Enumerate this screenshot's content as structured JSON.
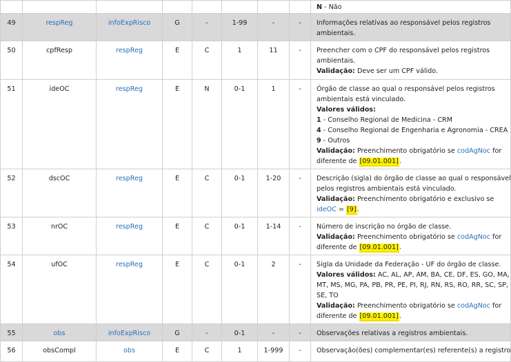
{
  "top_row": {
    "bold": "N",
    "text": " - Não"
  },
  "rows": [
    {
      "num": "49",
      "name": "respReg",
      "parent": "infoExpRisco",
      "type": "G",
      "occ": "-",
      "card": "1-99",
      "size": "-",
      "dec": "-",
      "desc": {
        "l1": "Informações relativas ao responsável pelos registros",
        "l2": "ambientais."
      }
    },
    {
      "num": "50",
      "name": "cpfResp",
      "parent": "respReg",
      "type": "E",
      "occ": "C",
      "card": "1",
      "size": "11",
      "dec": "-",
      "desc": {
        "l1": "Preencher com o CPF do responsável pelos registros",
        "l2": "ambientais.",
        "val_label": "Validação:",
        "val_text": " Deve ser um CPF válido."
      }
    },
    {
      "num": "51",
      "name": "ideOC",
      "parent": "respReg",
      "type": "E",
      "occ": "N",
      "card": "0-1",
      "size": "1",
      "dec": "-",
      "desc": {
        "l1": "Órgão de classe ao qual o responsável pelos registros",
        "l2": "ambientais está vinculado.",
        "valid_label": "Valores válidos:",
        "v1_code": "1",
        "v1_text": " - Conselho Regional de Medicina - CRM",
        "v2_code": "4",
        "v2_text": " - Conselho Regional de Engenharia e Agronomia - CREA",
        "v3_code": "9",
        "v3_text": " - Outros",
        "val_label": "Validação:",
        "val_text": " Preenchimento obrigatório se ",
        "val_link": "codAgNoc",
        "val_text2": " for",
        "val_l2": "diferente de ",
        "val_hl": "[09.01.001]",
        "val_end": "."
      }
    },
    {
      "num": "52",
      "name": "dscOC",
      "parent": "respReg",
      "type": "E",
      "occ": "C",
      "card": "0-1",
      "size": "1-20",
      "dec": "-",
      "desc": {
        "l1": "Descrição (sigla) do órgão de classe ao qual o responsável",
        "l2": "pelos registros ambientais está vinculado.",
        "val_label": "Validação:",
        "val_text": " Preenchimento obrigatório e exclusivo se",
        "val_link": "ideOC",
        "val_eq": " = ",
        "val_hl": "[9]",
        "val_end": "."
      }
    },
    {
      "num": "53",
      "name": "nrOC",
      "parent": "respReg",
      "type": "E",
      "occ": "C",
      "card": "0-1",
      "size": "1-14",
      "dec": "-",
      "desc": {
        "l1": "Número de inscrição no órgão de classe.",
        "val_label": "Validação:",
        "val_text": " Preenchimento obrigatório se ",
        "val_link": "codAgNoc",
        "val_text2": " for",
        "val_l2": "diferente de ",
        "val_hl": "[09.01.001]",
        "val_end": "."
      }
    },
    {
      "num": "54",
      "name": "ufOC",
      "parent": "respReg",
      "type": "E",
      "occ": "C",
      "card": "0-1",
      "size": "2",
      "dec": "-",
      "desc": {
        "l1": "Sigla da Unidade da Federação - UF do órgão de classe.",
        "valid_label": "Valores válidos:",
        "valid_l1": " AC, AL, AP, AM, BA, CE, DF, ES, GO, MA,",
        "valid_l2": "MT, MS, MG, PA, PB, PR, PE, PI, RJ, RN, RS, RO, RR, SC, SP,",
        "valid_l3": "SE, TO",
        "val_label": "Validação:",
        "val_text": " Preenchimento obrigatório se ",
        "val_link": "codAgNoc",
        "val_text2": " for",
        "val_l2": "diferente de ",
        "val_hl": "[09.01.001]",
        "val_end": "."
      }
    },
    {
      "num": "55",
      "name": "obs",
      "parent": "infoExpRisco",
      "type": "G",
      "occ": "-",
      "card": "0-1",
      "size": "-",
      "dec": "-",
      "desc": {
        "l1": "Observações relativas a registros ambientais."
      }
    },
    {
      "num": "56",
      "name": "obsCompl",
      "parent": "obs",
      "type": "E",
      "occ": "C",
      "card": "1",
      "size": "1-999",
      "dec": "-",
      "desc": {
        "l1": "Observação(ões) complementar(es) referente(s) a registros"
      }
    }
  ]
}
